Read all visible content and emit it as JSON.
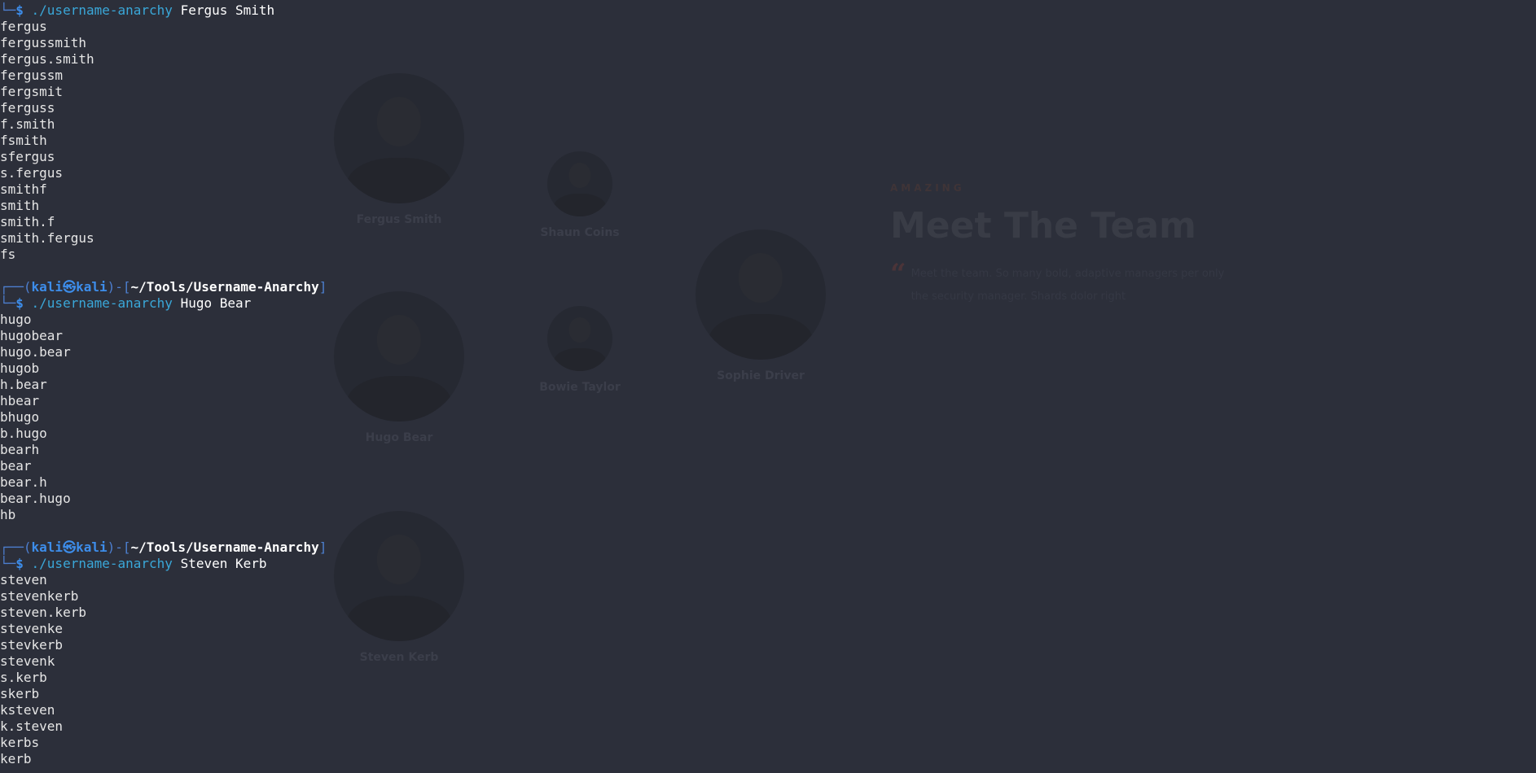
{
  "website": {
    "kicker": "AMAZING",
    "title": "Meet The Team",
    "description": "Meet the team. So many bold, adaptive managers per only the security manager. Shards dolor right",
    "members": [
      {
        "name": "Fergus Smith"
      },
      {
        "name": "Shaun Coins"
      },
      {
        "name": "Sophie Driver"
      },
      {
        "name": "Hugo Bear"
      },
      {
        "name": "Bowie Taylor"
      },
      {
        "name": "Steven Kerb"
      }
    ]
  },
  "terminal": {
    "prompt": {
      "user": "kali",
      "separator": "㉿",
      "host": "kali",
      "path": "~/Tools/Username-Anarchy",
      "command": "./username-anarchy"
    },
    "sessions": [
      {
        "args": "Fergus Smith",
        "output": [
          "fergus",
          "fergussmith",
          "fergus.smith",
          "fergussm",
          "fergsmit",
          "ferguss",
          "f.smith",
          "fsmith",
          "sfergus",
          "s.fergus",
          "smithf",
          "smith",
          "smith.f",
          "smith.fergus",
          "fs"
        ]
      },
      {
        "args": "Hugo Bear",
        "output": [
          "hugo",
          "hugobear",
          "hugo.bear",
          "hugob",
          "h.bear",
          "hbear",
          "bhugo",
          "b.hugo",
          "bearh",
          "bear",
          "bear.h",
          "bear.hugo",
          "hb"
        ]
      },
      {
        "args": "Steven Kerb",
        "output": [
          "steven",
          "stevenkerb",
          "steven.kerb",
          "stevenke",
          "stevkerb",
          "stevenk",
          "s.kerb",
          "skerb",
          "ksteven",
          "k.steven",
          "kerbs",
          "kerb"
        ]
      }
    ]
  },
  "colors": {
    "background": "#2c2f3a",
    "prompt_blue": "#3d8dea",
    "command_cyan": "#3aa7d8",
    "output_text": "#e6e6e6"
  }
}
